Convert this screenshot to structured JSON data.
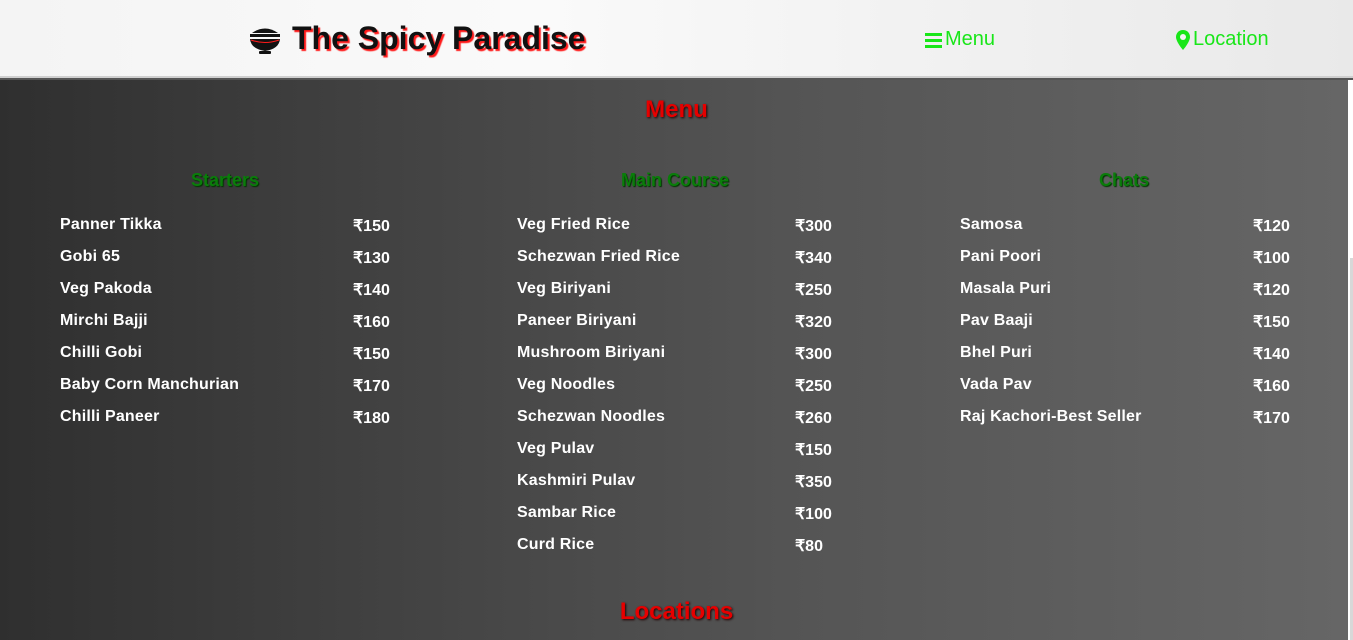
{
  "header": {
    "brand_name": "The Spicy Paradise",
    "brand_icon": "bowl-icon",
    "nav": [
      {
        "label": "Menu",
        "icon": "hamburger-icon"
      },
      {
        "label": "Location",
        "icon": "map-pin-icon"
      }
    ]
  },
  "menu": {
    "title": "Menu",
    "columns": [
      {
        "title": "Starters",
        "items": [
          {
            "name": "Panner Tikka",
            "price": "₹150"
          },
          {
            "name": "Gobi 65",
            "price": "₹130"
          },
          {
            "name": "Veg Pakoda",
            "price": "₹140"
          },
          {
            "name": "Mirchi Bajji",
            "price": "₹160"
          },
          {
            "name": "Chilli Gobi",
            "price": "₹150"
          },
          {
            "name": "Baby Corn Manchurian",
            "price": "₹170"
          },
          {
            "name": "Chilli Paneer",
            "price": "₹180"
          }
        ]
      },
      {
        "title": "Main Course",
        "items": [
          {
            "name": "Veg Fried Rice",
            "price": "₹300"
          },
          {
            "name": "Schezwan Fried Rice",
            "price": "₹340"
          },
          {
            "name": "Veg Biriyani",
            "price": "₹250"
          },
          {
            "name": "Paneer Biriyani",
            "price": "₹320"
          },
          {
            "name": "Mushroom Biriyani",
            "price": "₹300"
          },
          {
            "name": "Veg Noodles",
            "price": "₹250"
          },
          {
            "name": "Schezwan Noodles",
            "price": "₹260"
          },
          {
            "name": "Veg Pulav",
            "price": "₹150"
          },
          {
            "name": "Kashmiri Pulav",
            "price": "₹350"
          },
          {
            "name": "Sambar Rice",
            "price": "₹100"
          },
          {
            "name": "Curd Rice",
            "price": "₹80"
          }
        ]
      },
      {
        "title": "Chats",
        "items": [
          {
            "name": "Samosa",
            "price": "₹120"
          },
          {
            "name": "Pani Poori",
            "price": "₹100"
          },
          {
            "name": "Masala Puri",
            "price": "₹120"
          },
          {
            "name": "Pav Baaji",
            "price": "₹150"
          },
          {
            "name": "Bhel Puri",
            "price": "₹140"
          },
          {
            "name": "Vada Pav",
            "price": "₹160"
          },
          {
            "name": "Raj Kachori-Best Seller",
            "price": "₹170"
          }
        ]
      }
    ]
  },
  "locations": {
    "title": "Locations"
  },
  "colors": {
    "accent_red": "#e60000",
    "nav_green": "#19e619",
    "column_green": "#0a7d0a"
  }
}
